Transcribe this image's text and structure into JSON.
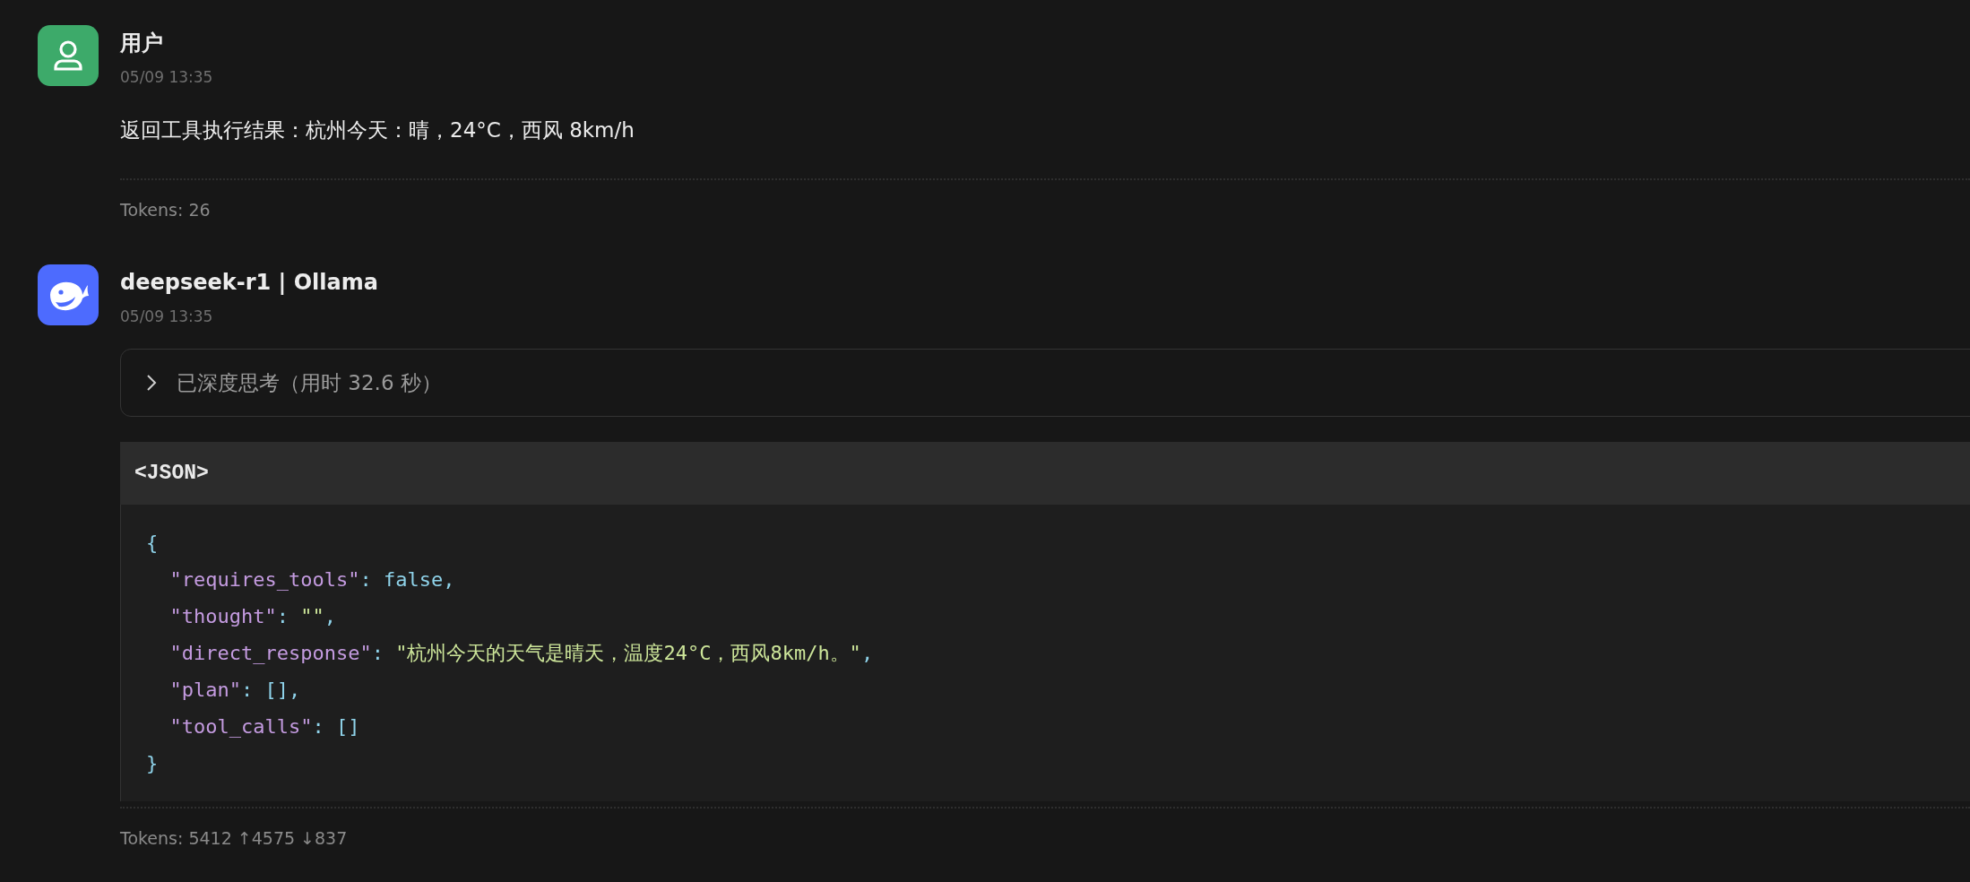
{
  "messages": [
    {
      "kind": "user",
      "name": "用户",
      "time": "05/09 13:35",
      "text": "返回工具执行结果：杭州今天：晴，24°C，西风 8km/h",
      "tokens": "Tokens: 26"
    },
    {
      "kind": "assistant",
      "name": "deepseek-r1 | Ollama",
      "time": "05/09 13:35",
      "thinking": {
        "label": "已深度思考（用时 32.6 秒）",
        "expanded": false
      },
      "code": {
        "language": "<JSON>",
        "lines": [
          [
            {
              "kind": "punct",
              "text": "{"
            }
          ],
          [
            {
              "kind": "key",
              "text": "  \"requires_tools\""
            },
            {
              "kind": "punct",
              "text": ": "
            },
            {
              "kind": "literal",
              "text": "false"
            },
            {
              "kind": "punct",
              "text": ","
            }
          ],
          [
            {
              "kind": "key",
              "text": "  \"thought\""
            },
            {
              "kind": "punct",
              "text": ": "
            },
            {
              "kind": "string",
              "text": "\"\""
            },
            {
              "kind": "punct",
              "text": ","
            }
          ],
          [
            {
              "kind": "key",
              "text": "  \"direct_response\""
            },
            {
              "kind": "punct",
              "text": ": "
            },
            {
              "kind": "string",
              "text": "\"杭州今天的天气是晴天，温度24°C，西风8km/h。\""
            },
            {
              "kind": "punct",
              "text": ","
            }
          ],
          [
            {
              "kind": "key",
              "text": "  \"plan\""
            },
            {
              "kind": "punct",
              "text": ": "
            },
            {
              "kind": "literal",
              "text": "[]"
            },
            {
              "kind": "punct",
              "text": ","
            }
          ],
          [
            {
              "kind": "key",
              "text": "  \"tool_calls\""
            },
            {
              "kind": "punct",
              "text": ": "
            },
            {
              "kind": "literal",
              "text": "[]"
            }
          ],
          [
            {
              "kind": "punct",
              "text": "}"
            }
          ]
        ]
      },
      "tokens": "Tokens: 5412 ↑4575 ↓837"
    }
  ]
}
